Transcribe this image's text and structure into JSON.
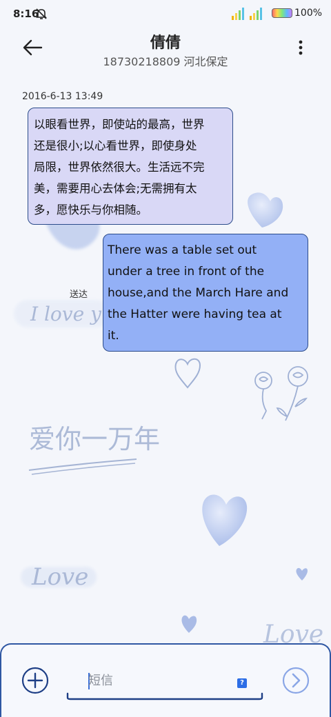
{
  "status_bar": {
    "time": "8:16",
    "battery_percent": "100%",
    "icons": [
      "bell-off-icon",
      "signal-icon",
      "signal-icon",
      "battery-icon"
    ]
  },
  "header": {
    "contact_name": "倩倩",
    "contact_detail": "18730218809 河北保定",
    "back_icon": "arrow-left-icon",
    "menu_icon": "more-vertical-icon"
  },
  "messages": [
    {
      "direction": "incoming",
      "timestamp": "2016-6-13 13:49",
      "lines": [
        "以眼看世界，即使站的最高，世界",
        "还是很小;以心看世界，即使身处",
        "局限，世界依然很大。生活远不完",
        "美，需要用心去体会;无需拥有太",
        "多，愿快乐与你相随。"
      ]
    },
    {
      "direction": "outgoing",
      "status": "送达",
      "lines": [
        "There was a table set out",
        "under a tree in front of the",
        "house,and the March Hare and",
        "the Hatter were having tea at",
        "it."
      ]
    }
  ],
  "wallpaper": {
    "texts": [
      "I love y",
      "爱你一万年",
      "Love",
      "Love"
    ]
  },
  "composer": {
    "placeholder": "短信",
    "plus_icon": "plus-circle-icon",
    "send_icon": "send-arrow-icon",
    "sim_badge": "?"
  },
  "colors": {
    "incoming_bubble": "#d9d8f6",
    "outgoing_bubble": "#93b0f6",
    "accent": "#2f57a3"
  }
}
